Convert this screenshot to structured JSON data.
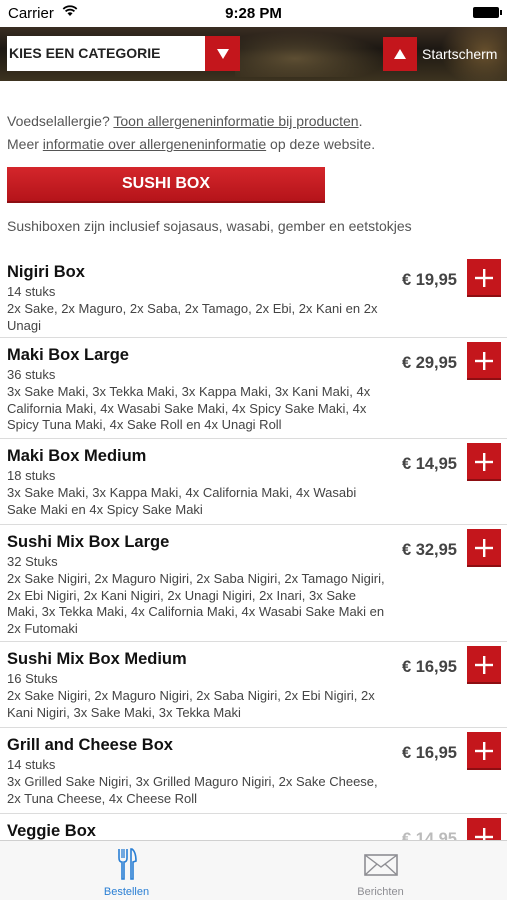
{
  "status_bar": {
    "carrier": "Carrier",
    "time": "9:28 PM"
  },
  "header": {
    "category_placeholder": "KIES EEN CATEGORIE",
    "home_label": "Startscherm"
  },
  "info": {
    "allergy_prefix": "Voedselallergie? ",
    "allergy_link": "Toon allergeneninformatie bij producten",
    "allergy_suffix": ".",
    "more_prefix": "Meer ",
    "more_link": "informatie over allergeneninformatie",
    "more_suffix": " op deze website."
  },
  "section": {
    "title": "SUSHI BOX",
    "subtitle": "Sushiboxen zijn inclusief sojasaus, wasabi, gember en eetstokjes"
  },
  "products": [
    {
      "name": "Nigiri Box",
      "count": "14 stuks",
      "desc": "2x Sake, 2x Maguro, 2x Saba, 2x Tamago, 2x Ebi, 2x Kani en 2x Unagi",
      "price": "€ 19,95"
    },
    {
      "name": "Maki Box Large",
      "count": "36 stuks",
      "desc": "3x Sake Maki, 3x Tekka Maki, 3x Kappa Maki, 3x Kani Maki, 4x California Maki, 4x Wasabi Sake Maki, 4x Spicy Sake Maki, 4x Spicy Tuna Maki, 4x Sake Roll en 4x Unagi Roll",
      "price": "€ 29,95"
    },
    {
      "name": "Maki Box Medium",
      "count": "18 stuks",
      "desc": "3x Sake Maki, 3x Kappa Maki, 4x California Maki, 4x Wasabi Sake Maki en 4x Spicy Sake Maki",
      "price": "€ 14,95"
    },
    {
      "name": "Sushi Mix Box Large",
      "count": "32 Stuks",
      "desc": "2x Sake Nigiri, 2x Maguro Nigiri, 2x Saba Nigiri, 2x Tamago Nigiri, 2x Ebi Nigiri, 2x Kani Nigiri, 2x Unagi Nigiri, 2x Inari, 3x Sake Maki, 3x Tekka Maki, 4x California Maki, 4x Wasabi Sake Maki en 2x Futomaki",
      "price": "€ 32,95"
    },
    {
      "name": "Sushi Mix Box Medium",
      "count": "16 Stuks",
      "desc": "2x Sake Nigiri, 2x Maguro Nigiri, 2x Saba Nigiri, 2x Ebi Nigiri, 2x Kani Nigiri, 3x Sake Maki, 3x Tekka Maki",
      "price": "€ 16,95"
    },
    {
      "name": "Grill and Cheese Box",
      "count": "14 stuks",
      "desc": "3x Grilled Sake Nigiri, 3x Grilled Maguro Nigiri, 2x Sake Cheese, 2x Tuna Cheese, 4x Cheese Roll",
      "price": "€ 16,95"
    },
    {
      "name": "Veggie Box",
      "count": "",
      "desc": "",
      "price": "€ 14,95"
    }
  ],
  "tabs": [
    {
      "label": "Bestellen",
      "icon": "fork-knife-icon",
      "active": true
    },
    {
      "label": "Berichten",
      "icon": "envelope-icon",
      "active": false
    }
  ],
  "colors": {
    "accent": "#c4161c",
    "tab_active": "#2a7fd4",
    "tab_inactive": "#8e8e93"
  }
}
